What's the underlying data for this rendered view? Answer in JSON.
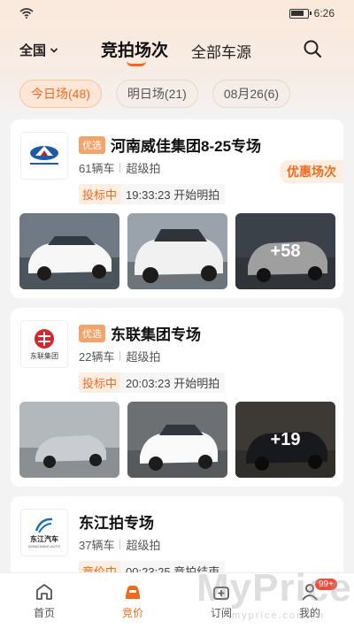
{
  "status_bar": {
    "time": "6:26"
  },
  "header": {
    "region": "全国",
    "tab_active": "竞拍场次",
    "tab_other": "全部车源"
  },
  "chips": [
    {
      "label": "今日场(48)",
      "active": true
    },
    {
      "label": "明日场(21)",
      "active": false
    },
    {
      "label": "08月26(6)",
      "active": false
    }
  ],
  "sessions": [
    {
      "badge": "优选",
      "title": "河南威佳集团8-25专场",
      "car_count": "61辆车",
      "level": "超级拍",
      "status": "投标中",
      "time_text": "19:33:23 开始明拍",
      "promo": "优惠场次",
      "more": "+58",
      "photo_colors": [
        "#ffffff",
        "#f2f2f2",
        "#ffffff"
      ]
    },
    {
      "badge": "优选",
      "title": "东联集团专场",
      "logo_text": "东联集团",
      "car_count": "22辆车",
      "level": "超级拍",
      "status": "投标中",
      "time_text": "20:03:23 开始明拍",
      "more": "+19",
      "photo_colors": [
        "#c9ccd0",
        "#ffffff",
        "#2a2c30"
      ]
    },
    {
      "title": "东江拍专场",
      "logo_text": "东江汽车",
      "logo_sub": "DONGJIANG AUTO",
      "car_count": "37辆车",
      "level": "超级拍",
      "status": "竞价中",
      "time_text": "00:23:25 竞拍结束"
    }
  ],
  "bottom_nav": [
    {
      "label": "首页",
      "icon": "home-icon",
      "active": false
    },
    {
      "label": "竞价",
      "icon": "auction-car-icon",
      "active": true
    },
    {
      "label": "订阅",
      "icon": "subscribe-icon",
      "active": false
    },
    {
      "label": "我的",
      "icon": "profile-icon",
      "active": false,
      "badge": "99+"
    }
  ],
  "watermark": {
    "main": "MyPrice",
    "sub": "myprice.com.cn"
  },
  "colors": {
    "accent": "#f06a1e",
    "badge_red": "#f24a3b"
  }
}
